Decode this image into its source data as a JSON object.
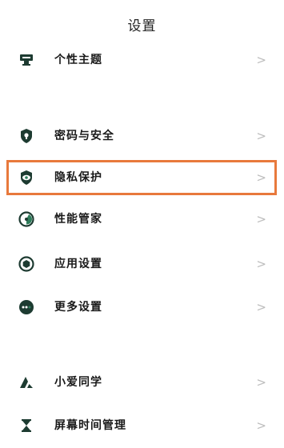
{
  "header": {
    "title": "设置"
  },
  "items": [
    {
      "label": "个性主题",
      "icon": "theme-icon"
    },
    {
      "label": "密码与安全",
      "icon": "shield-icon"
    },
    {
      "label": "隐私保护",
      "icon": "privacy-icon"
    },
    {
      "label": "性能管家",
      "icon": "performance-icon"
    },
    {
      "label": "应用设置",
      "icon": "app-settings-icon"
    },
    {
      "label": "更多设置",
      "icon": "more-settings-icon"
    },
    {
      "label": "小爱同学",
      "icon": "assistant-icon"
    },
    {
      "label": "屏幕时间管理",
      "icon": "hourglass-icon"
    }
  ],
  "chevron": ">",
  "colors": {
    "icon_dark": "#1d3b31",
    "icon_accent": "#2e7d5b",
    "highlight": "#e8793c",
    "chevron": "#bdbdbd"
  },
  "highlighted_item": "隐私保护"
}
